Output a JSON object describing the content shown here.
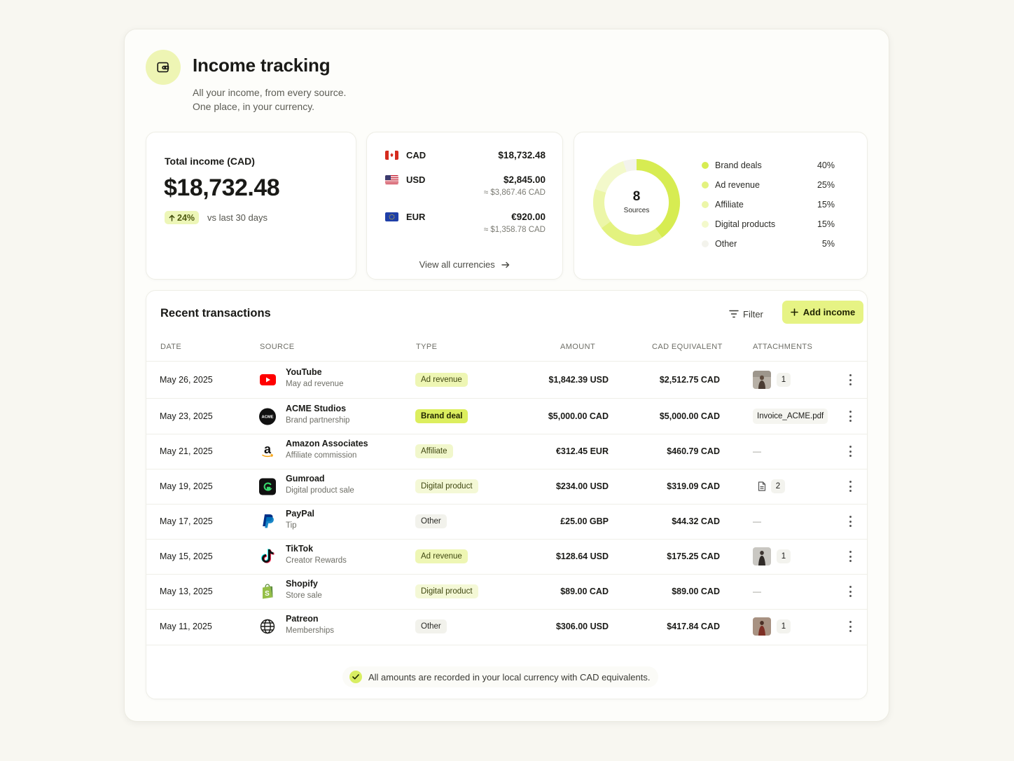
{
  "header": {
    "title": "Income tracking",
    "subtitle_line1": "All your income, from every source.",
    "subtitle_line2": "One place, in your currency.",
    "icon": "wallet-icon"
  },
  "total": {
    "label": "Total income (CAD)",
    "value": "$18,732.48",
    "change": "24%",
    "change_label": "vs last 30 days"
  },
  "currencies": {
    "items": [
      {
        "code": "CAD",
        "amount": "$18,732.48",
        "conversion": ""
      },
      {
        "code": "USD",
        "amount": "$2,845.00",
        "conversion": "≈ $3,867.46 CAD"
      },
      {
        "code": "EUR",
        "amount": "€920.00",
        "conversion": "≈ $1,358.78 CAD"
      }
    ],
    "view_all": "View all currencies"
  },
  "sources": {
    "count": "8",
    "count_label": "Sources",
    "legend": [
      {
        "label": "Brand deals",
        "pct": "40%",
        "value": 40,
        "color": "#d7ec52"
      },
      {
        "label": "Ad revenue",
        "pct": "25%",
        "value": 25,
        "color": "#e3f27f"
      },
      {
        "label": "Affiliate",
        "pct": "15%",
        "value": 15,
        "color": "#ecf6a8"
      },
      {
        "label": "Digital products",
        "pct": "15%",
        "value": 15,
        "color": "#f3f9cb"
      },
      {
        "label": "Other",
        "pct": "5%",
        "value": 5,
        "color": "#f3f3ec"
      }
    ]
  },
  "transactions": {
    "title": "Recent transactions",
    "filter_label": "Filter",
    "add_label": "Add income",
    "columns": [
      "DATE",
      "SOURCE",
      "TYPE",
      "AMOUNT",
      "CAD EQUIVALENT",
      "ATTACHMENTS"
    ],
    "rows": [
      {
        "date": "May 26, 2025",
        "source": "YouTube",
        "detail": "May ad revenue",
        "type": "Ad revenue",
        "amount": "$1,842.39 USD",
        "cad": "$2,512.75 CAD",
        "attachment": "1"
      },
      {
        "date": "May 23, 2025",
        "source": "ACME Studios",
        "detail": "Brand partnership",
        "type": "Brand deal",
        "amount": "$5,000.00 CAD",
        "cad": "$5,000.00 CAD",
        "attachment": "Invoice_ACME.pdf"
      },
      {
        "date": "May 21, 2025",
        "source": "Amazon Associates",
        "detail": "Affiliate commission",
        "type": "Affiliate",
        "amount": "€312.45 EUR",
        "cad": "$460.79 CAD",
        "attachment": "—"
      },
      {
        "date": "May 19, 2025",
        "source": "Gumroad",
        "detail": "Digital product sale",
        "type": "Digital product",
        "amount": "$234.00 USD",
        "cad": "$319.09 CAD",
        "attachment": "2"
      },
      {
        "date": "May 17, 2025",
        "source": "PayPal",
        "detail": "Tip",
        "type": "Other",
        "amount": "£25.00 GBP",
        "cad": "$44.32 CAD",
        "attachment": "—"
      },
      {
        "date": "May 15, 2025",
        "source": "TikTok",
        "detail": "Creator Rewards",
        "type": "Ad revenue",
        "amount": "$128.64 USD",
        "cad": "$175.25 CAD",
        "attachment": "1"
      },
      {
        "date": "May 13, 2025",
        "source": "Shopify",
        "detail": "Store sale",
        "type": "Digital product",
        "amount": "$89.00 CAD",
        "cad": "$89.00 CAD",
        "attachment": "—"
      },
      {
        "date": "May 11, 2025",
        "source": "Patreon",
        "detail": "Memberships",
        "type": "Other",
        "amount": "$306.00 USD",
        "cad": "$417.84 CAD",
        "attachment": "1"
      }
    ],
    "footer_note": "All amounts are recorded in your local currency with CAD equivalents."
  },
  "colors": {
    "accent": "#e6f384",
    "badge_ad": "#eef6b4",
    "badge_brand": "#dcee5e",
    "badge_affiliate": "#f1f7cc",
    "badge_digital": "#f4f8d6",
    "badge_other": "#f2f2ec"
  }
}
